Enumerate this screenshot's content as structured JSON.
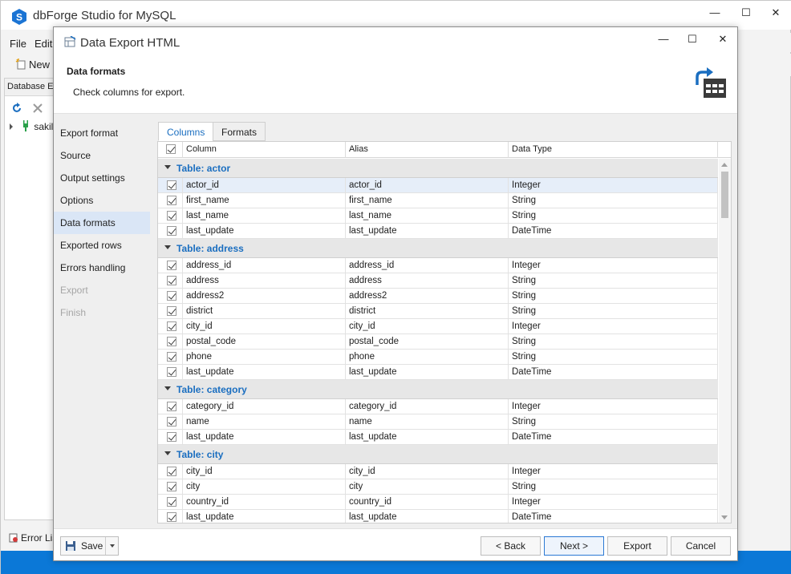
{
  "app": {
    "title": "dbForge Studio for MySQL",
    "menu": [
      "File",
      "Edit"
    ],
    "toolbar_new": "New S",
    "db_explorer_title": "Database Ex",
    "tree_item": "sakil",
    "error_list": "Error Lis",
    "colors": {
      "accent": "#0b78d7",
      "link": "#1a6ec0",
      "nav_active": "#dae6f6"
    }
  },
  "dialog": {
    "title": "Data Export HTML",
    "header_title": "Data formats",
    "header_subtitle": "Check columns for export.",
    "nav": [
      {
        "label": "Export format",
        "state": "normal"
      },
      {
        "label": "Source",
        "state": "normal"
      },
      {
        "label": "Output settings",
        "state": "normal"
      },
      {
        "label": "Options",
        "state": "normal"
      },
      {
        "label": "Data formats",
        "state": "active"
      },
      {
        "label": "Exported rows",
        "state": "normal"
      },
      {
        "label": "Errors handling",
        "state": "normal"
      },
      {
        "label": "Export",
        "state": "disabled"
      },
      {
        "label": "Finish",
        "state": "disabled"
      }
    ],
    "tabs": [
      "Columns",
      "Formats"
    ],
    "active_tab": "Columns",
    "grid": {
      "headers": {
        "column": "Column",
        "alias": "Alias",
        "type": "Data Type"
      },
      "groups": [
        {
          "label": "Table: actor",
          "rows": [
            {
              "column": "actor_id",
              "alias": "actor_id",
              "type": "Integer",
              "selected": true
            },
            {
              "column": "first_name",
              "alias": "first_name",
              "type": "String"
            },
            {
              "column": "last_name",
              "alias": "last_name",
              "type": "String"
            },
            {
              "column": "last_update",
              "alias": "last_update",
              "type": "DateTime"
            }
          ]
        },
        {
          "label": "Table: address",
          "rows": [
            {
              "column": "address_id",
              "alias": "address_id",
              "type": "Integer"
            },
            {
              "column": "address",
              "alias": "address",
              "type": "String"
            },
            {
              "column": "address2",
              "alias": "address2",
              "type": "String"
            },
            {
              "column": "district",
              "alias": "district",
              "type": "String"
            },
            {
              "column": "city_id",
              "alias": "city_id",
              "type": "Integer"
            },
            {
              "column": "postal_code",
              "alias": "postal_code",
              "type": "String"
            },
            {
              "column": "phone",
              "alias": "phone",
              "type": "String"
            },
            {
              "column": "last_update",
              "alias": "last_update",
              "type": "DateTime"
            }
          ]
        },
        {
          "label": "Table: category",
          "rows": [
            {
              "column": "category_id",
              "alias": "category_id",
              "type": "Integer"
            },
            {
              "column": "name",
              "alias": "name",
              "type": "String"
            },
            {
              "column": "last_update",
              "alias": "last_update",
              "type": "DateTime"
            }
          ]
        },
        {
          "label": "Table: city",
          "rows": [
            {
              "column": "city_id",
              "alias": "city_id",
              "type": "Integer"
            },
            {
              "column": "city",
              "alias": "city",
              "type": "String"
            },
            {
              "column": "country_id",
              "alias": "country_id",
              "type": "Integer"
            },
            {
              "column": "last_update",
              "alias": "last_update",
              "type": "DateTime"
            }
          ]
        }
      ]
    },
    "footer": {
      "save": "Save",
      "back": "< Back",
      "next": "Next >",
      "export": "Export",
      "cancel": "Cancel"
    }
  }
}
